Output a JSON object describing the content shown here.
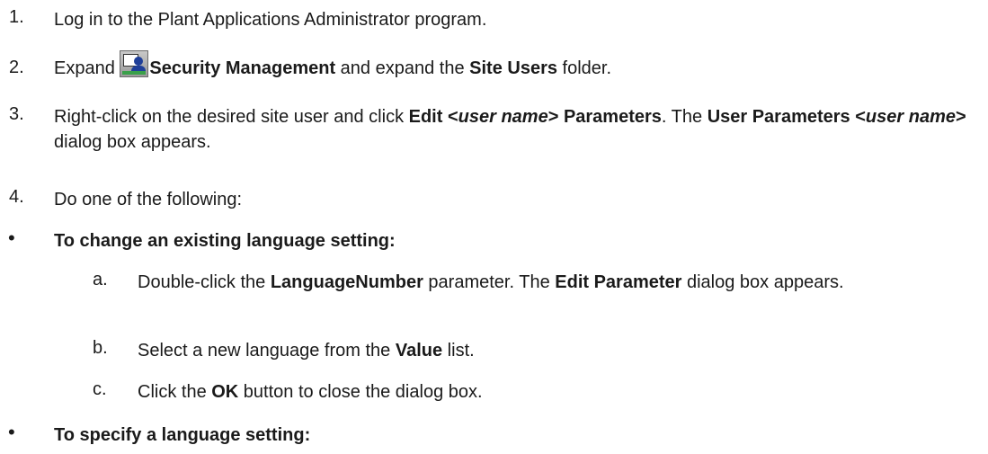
{
  "steps": [
    {
      "num": "1.",
      "text": "Log in to the Plant Applications Administrator program."
    },
    {
      "num": "2.",
      "pre": "Expand ",
      "bold1": "Security Management",
      "mid": " and expand the ",
      "bold2": "Site Users",
      "post": " folder."
    },
    {
      "num": "3.",
      "pre": "Right-click on the desired site user and click ",
      "b1a": "Edit <",
      "b1i": "user name",
      "b1b": "> Parameters",
      "mid": ". The ",
      "b2a": "User Parameters <",
      "b2i": "user name",
      "b2b": ">",
      "post": " dialog box appears."
    },
    {
      "num": "4.",
      "text": "Do one of the following:"
    }
  ],
  "options": [
    {
      "bullet": "•",
      "title": "To change an existing language setting:",
      "substeps": [
        {
          "letter": "a.",
          "pre": "Double-click the ",
          "bold1": "LanguageNumber",
          "mid": " parameter. The ",
          "bold2": "Edit Parameter",
          "post": " dialog box appears."
        },
        {
          "letter": "b.",
          "pre": "Select a new language from the ",
          "bold1": "Value",
          "post": " list."
        },
        {
          "letter": "c.",
          "pre": "Click the ",
          "bold1": "OK",
          "post": " button to close the dialog box."
        }
      ]
    },
    {
      "bullet": "•",
      "title": "To specify a language setting:"
    }
  ],
  "icons": {
    "security_management": "security-management-icon"
  }
}
